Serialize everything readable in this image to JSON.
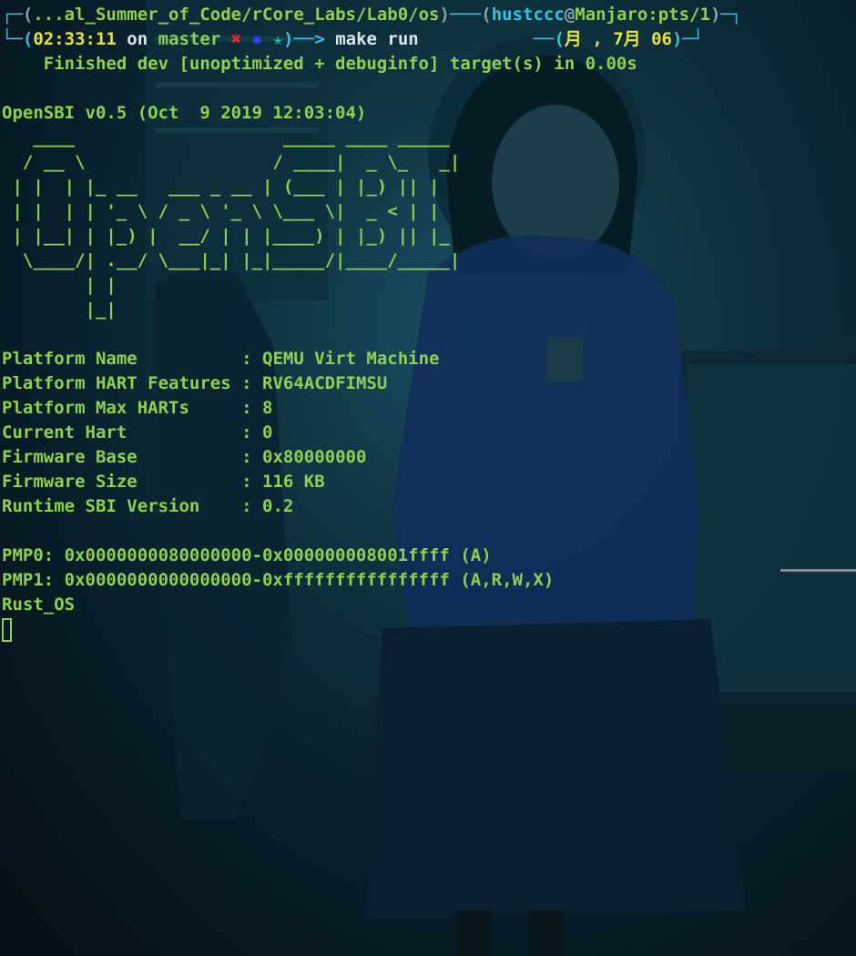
{
  "prompt": {
    "corner_tl": "┌─",
    "corner_bl": "└─",
    "path_open": "(",
    "path": "...al_Summer_of_Code/rCore_Labs/Lab0/os",
    "path_close": ")",
    "dash1": "───",
    "user_open": "(",
    "user": "hustccc",
    "at": "@",
    "host": "Manjaro:pts/1",
    "user_close": ")",
    "corner_tr": "─┐",
    "time_open": "(",
    "time": "02:33:11",
    "on": " on ",
    "branch": "master",
    "x_mark": "✖",
    "sun_mark": "✹",
    "star_mark": "✭",
    "time_close": ")",
    "arrow": "──>",
    "command": "make run",
    "date_dash": "──(",
    "date": "月 , 7月 06",
    "date_close": ")",
    "corner_br": "─┘"
  },
  "cargo_line": "    Finished dev [unoptimized + debuginfo] target(s) in 0.00s",
  "opensbi_version": "OpenSBI v0.5 (Oct  9 2019 12:03:04)",
  "ascii_logo": [
    "   ____                    _____ ____ _____",
    "  / __ \\                  / ____|  _ \\_   _|",
    " | |  | |_ __   ___ _ __ | (___ | |_) || |",
    " | |  | | '_ \\ / _ \\ '_ \\ \\___ \\|  _ < | |",
    " | |__| | |_) |  __/ | | |____) | |_) || |_",
    "  \\____/| .__/ \\___|_| |_|_____/|____/_____|",
    "        | |",
    "        |_|"
  ],
  "platform_info": [
    {
      "key": "Platform Name         ",
      "value": "QEMU Virt Machine"
    },
    {
      "key": "Platform HART Features",
      "value": "RV64ACDFIMSU"
    },
    {
      "key": "Platform Max HARTs    ",
      "value": "8"
    },
    {
      "key": "Current Hart          ",
      "value": "0"
    },
    {
      "key": "Firmware Base         ",
      "value": "0x80000000"
    },
    {
      "key": "Firmware Size         ",
      "value": "116 KB"
    },
    {
      "key": "Runtime SBI Version   ",
      "value": "0.2"
    }
  ],
  "pmp": [
    "PMP0: 0x0000000080000000-0x000000008001ffff (A)",
    "PMP1: 0x0000000000000000-0xffffffffffffffff (A,R,W,X)"
  ],
  "os_output": "Rust_OS",
  "colors": {
    "prompt_frame": "#31c3e7",
    "output_text": "#8fd14f",
    "time": "#e6e33c",
    "error_mark": "#e02a2a"
  }
}
